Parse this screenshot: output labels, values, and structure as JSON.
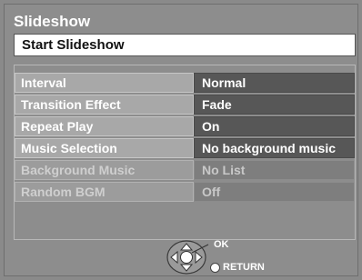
{
  "screen": {
    "title": "Slideshow"
  },
  "start_button": {
    "label": "Start Slideshow"
  },
  "settings": [
    {
      "label": "Interval",
      "value": "Normal",
      "enabled": true
    },
    {
      "label": "Transition Effect",
      "value": "Fade",
      "enabled": true
    },
    {
      "label": "Repeat Play",
      "value": "On",
      "enabled": true
    },
    {
      "label": "Music Selection",
      "value": "No background music",
      "enabled": true
    },
    {
      "label": "Background Music",
      "value": "No List",
      "enabled": false
    },
    {
      "label": "Random BGM",
      "value": "Off",
      "enabled": false
    }
  ],
  "footer": {
    "ok_label": "OK",
    "return_label": "RETURN"
  },
  "icons": {
    "navigation": "dpad-ok-icon",
    "return": "return-button-icon"
  }
}
